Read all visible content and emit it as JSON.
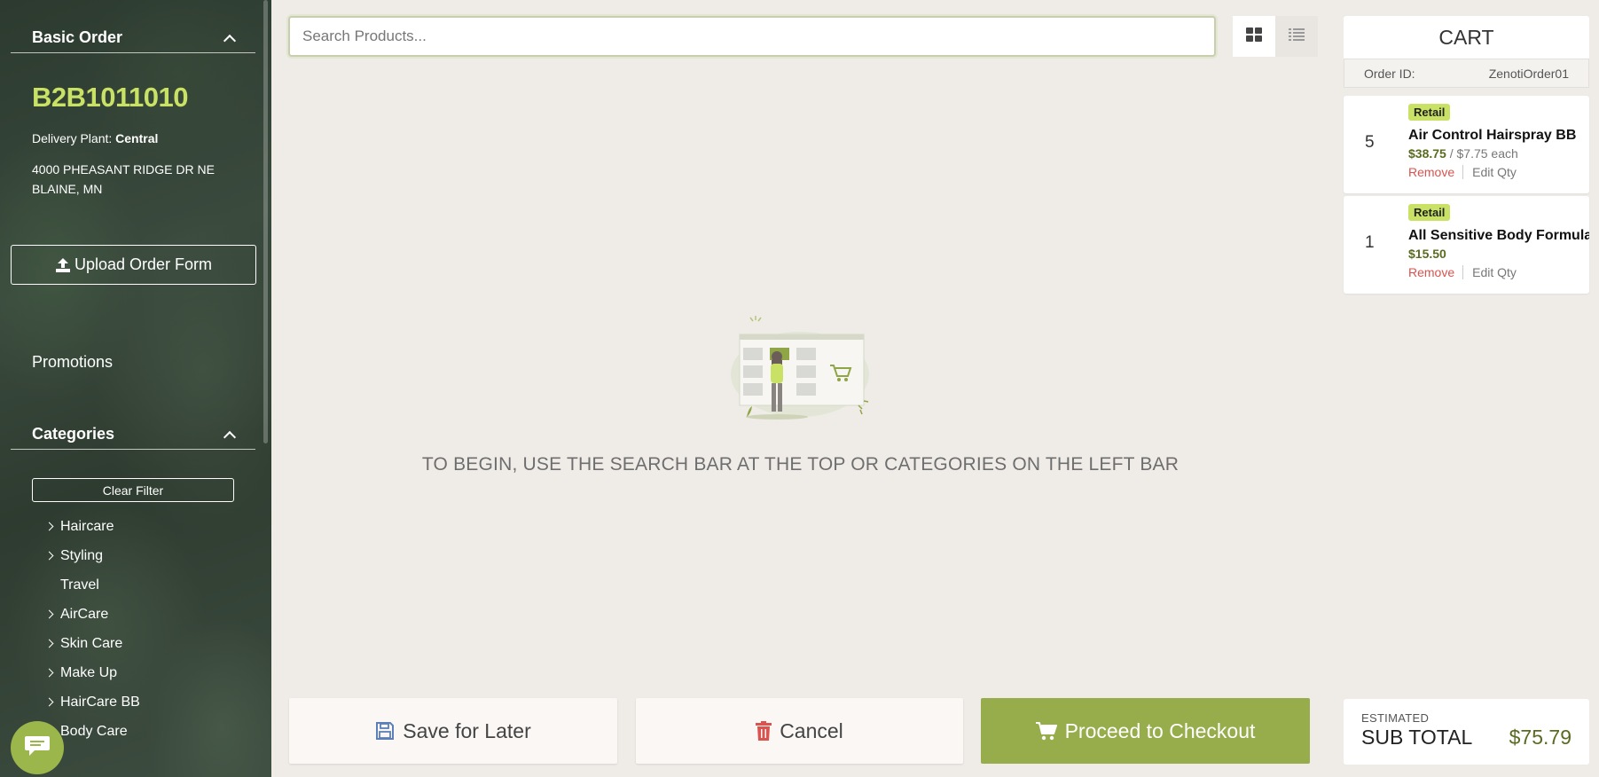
{
  "sidebar": {
    "basic_order_title": "Basic Order",
    "order_number": "B2B1011010",
    "delivery_plant_label": "Delivery Plant:",
    "delivery_plant_value": "Central",
    "address_line1": "4000 PHEASANT RIDGE DR NE",
    "address_line2": "BLAINE, MN",
    "upload_label": "Upload Order Form",
    "promotions_label": "Promotions",
    "categories_title": "Categories",
    "clear_filter_label": "Clear Filter",
    "categories": [
      {
        "label": "Haircare",
        "expandable": true
      },
      {
        "label": "Styling",
        "expandable": true
      },
      {
        "label": "Travel",
        "expandable": false
      },
      {
        "label": "AirCare",
        "expandable": true
      },
      {
        "label": "Skin Care",
        "expandable": true
      },
      {
        "label": "Make Up",
        "expandable": true
      },
      {
        "label": "HairCare BB",
        "expandable": true
      },
      {
        "label": "Body Care",
        "expandable": false
      }
    ]
  },
  "search": {
    "placeholder": "Search Products..."
  },
  "main": {
    "empty_message": "TO BEGIN, USE THE SEARCH BAR AT THE TOP OR CATEGORIES ON THE LEFT BAR"
  },
  "actions": {
    "save_label": "Save for Later",
    "cancel_label": "Cancel",
    "checkout_label": "Proceed to Checkout"
  },
  "cart": {
    "title": "CART",
    "order_id_label": "Order ID:",
    "order_id_value": "ZenotiOrder01",
    "items": [
      {
        "qty": "5",
        "badge": "Retail",
        "name": "Air Control Hairspray BB",
        "total": "$38.75",
        "unit": "/ $7.75 each",
        "remove_label": "Remove",
        "edit_label": "Edit Qty"
      },
      {
        "qty": "1",
        "badge": "Retail",
        "name": "All Sensitive Body Formula",
        "total": "$15.50",
        "unit": "",
        "remove_label": "Remove",
        "edit_label": "Edit Qty"
      }
    ],
    "estimated_label": "ESTIMATED",
    "subtotal_label": "SUB TOTAL",
    "subtotal_value": "$75.79"
  },
  "colors": {
    "accent_green": "#97ad4b",
    "order_number_green": "#c9e265",
    "remove_red": "#d9534f"
  }
}
